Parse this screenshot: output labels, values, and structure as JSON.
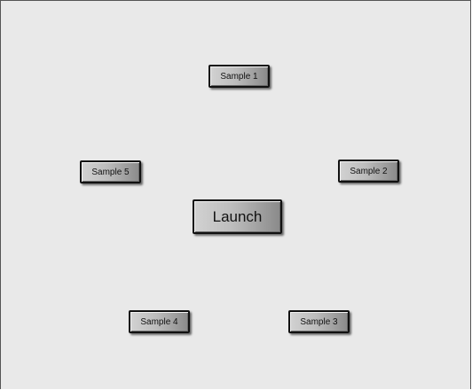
{
  "buttons": {
    "sample1": "Sample 1",
    "sample2": "Sample 2",
    "sample3": "Sample 3",
    "sample4": "Sample 4",
    "sample5": "Sample 5",
    "launch": "Launch"
  }
}
